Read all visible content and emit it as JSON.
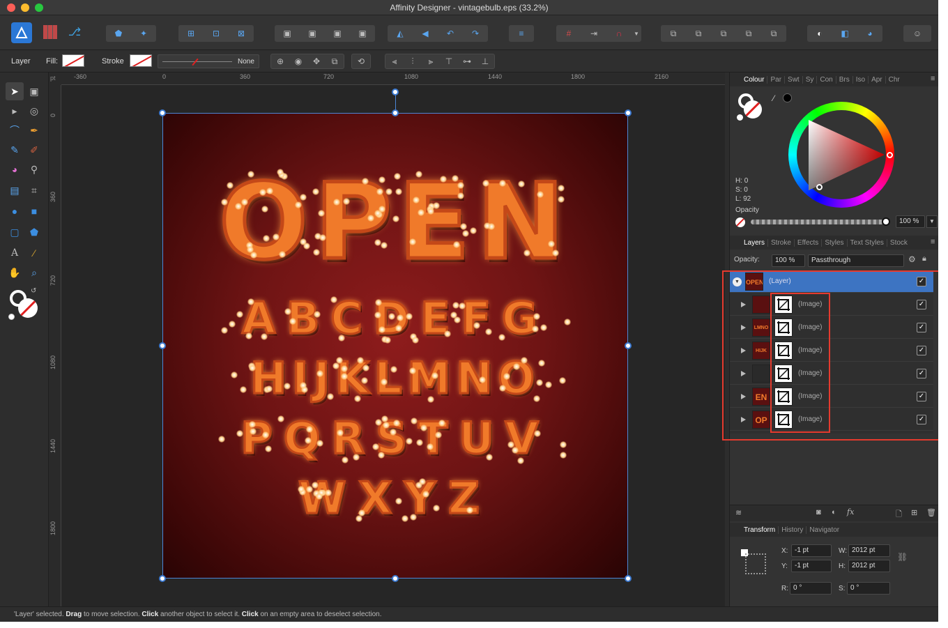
{
  "window": {
    "title": "Affinity Designer - vintagebulb.eps (33.2%)"
  },
  "toolbar": {
    "persona_icons": [
      "designer-persona-icon",
      "pixel-persona-icon",
      "export-persona-icon"
    ],
    "groups": [
      [
        "bucket-icon",
        "paint-icon"
      ],
      [
        "select-grid-icon",
        "select-bounds-icon",
        "transform-icon"
      ],
      [
        "arrange-back-icon",
        "arrange-backward-icon",
        "arrange-forward-icon",
        "arrange-front-icon"
      ],
      [
        "flip-h-icon",
        "flip-v-icon",
        "rotate-left-icon",
        "rotate-right-icon"
      ],
      [
        "align-icon"
      ],
      [
        "grid-icon",
        "snap-arrow-icon",
        "magnet-icon"
      ],
      [
        "add-boolean-icon",
        "subtract-boolean-icon",
        "intersect-boolean-icon",
        "xor-boolean-icon",
        "divide-boolean-icon"
      ],
      [
        "insert-inside-icon",
        "insert-behind-icon",
        "insert-front-icon"
      ],
      [
        "user-icon"
      ]
    ]
  },
  "context": {
    "layer_label": "Layer",
    "fill_label": "Fill:",
    "stroke_label": "Stroke",
    "stroke_value": "None"
  },
  "ruler": {
    "unit": "pt",
    "top_ticks": [
      "-360",
      "0",
      "360",
      "720",
      "1080",
      "1440",
      "1800",
      "2160"
    ],
    "left_ticks": [
      "0",
      "360",
      "720",
      "1080",
      "1440",
      "1800"
    ]
  },
  "artwork": {
    "headline": "OPEN",
    "rows": [
      "ABCDEFG",
      "HIJKLMNO",
      "PQRSTUV",
      "WXYZ"
    ]
  },
  "colour_panel": {
    "tabs": [
      "Colour",
      "Par",
      "Swt",
      "Sy",
      "Con",
      "Brs",
      "Iso",
      "Apr",
      "Chr"
    ],
    "h": "H: 0",
    "s": "S: 0",
    "l": "L: 92",
    "opacity_label": "Opacity",
    "opacity_value": "100 %"
  },
  "layers_panel": {
    "tabs": [
      "Layers",
      "Stroke",
      "Effects",
      "Styles",
      "Text Styles",
      "Stock"
    ],
    "opacity_label": "Opacity:",
    "opacity_value": "100 %",
    "blend_mode": "Passthrough",
    "parent": {
      "name": "(Layer)",
      "thumb": "OPEN"
    },
    "children": [
      {
        "name": "(Image)",
        "thumb": ""
      },
      {
        "name": "(Image)",
        "thumb": "LMNO"
      },
      {
        "name": "(Image)",
        "thumb": "HIJK"
      },
      {
        "name": "(Image)",
        "thumb": ""
      },
      {
        "name": "(Image)",
        "thumb": "EN"
      },
      {
        "name": "(Image)",
        "thumb": "OP"
      }
    ]
  },
  "transform_panel": {
    "tabs": [
      "Transform",
      "History",
      "Navigator"
    ],
    "x_label": "X:",
    "x_value": "-1 pt",
    "y_label": "Y:",
    "y_value": "-1 pt",
    "w_label": "W:",
    "w_value": "2012 pt",
    "h_label": "H:",
    "h_value": "2012 pt",
    "r_label": "R:",
    "r_value": "0 °",
    "s_label": "S:",
    "s_value": "0 °"
  },
  "status": {
    "p1": "'Layer' selected. ",
    "b1": "Drag",
    "p2": " to move selection. ",
    "b2": "Click",
    "p3": " another object to select it. ",
    "b3": "Click",
    "p4": " on an empty area to deselect selection."
  },
  "colors": {
    "accent": "#3d74c2",
    "highlight": "#e53a2e",
    "letters": "#f07a2a"
  }
}
